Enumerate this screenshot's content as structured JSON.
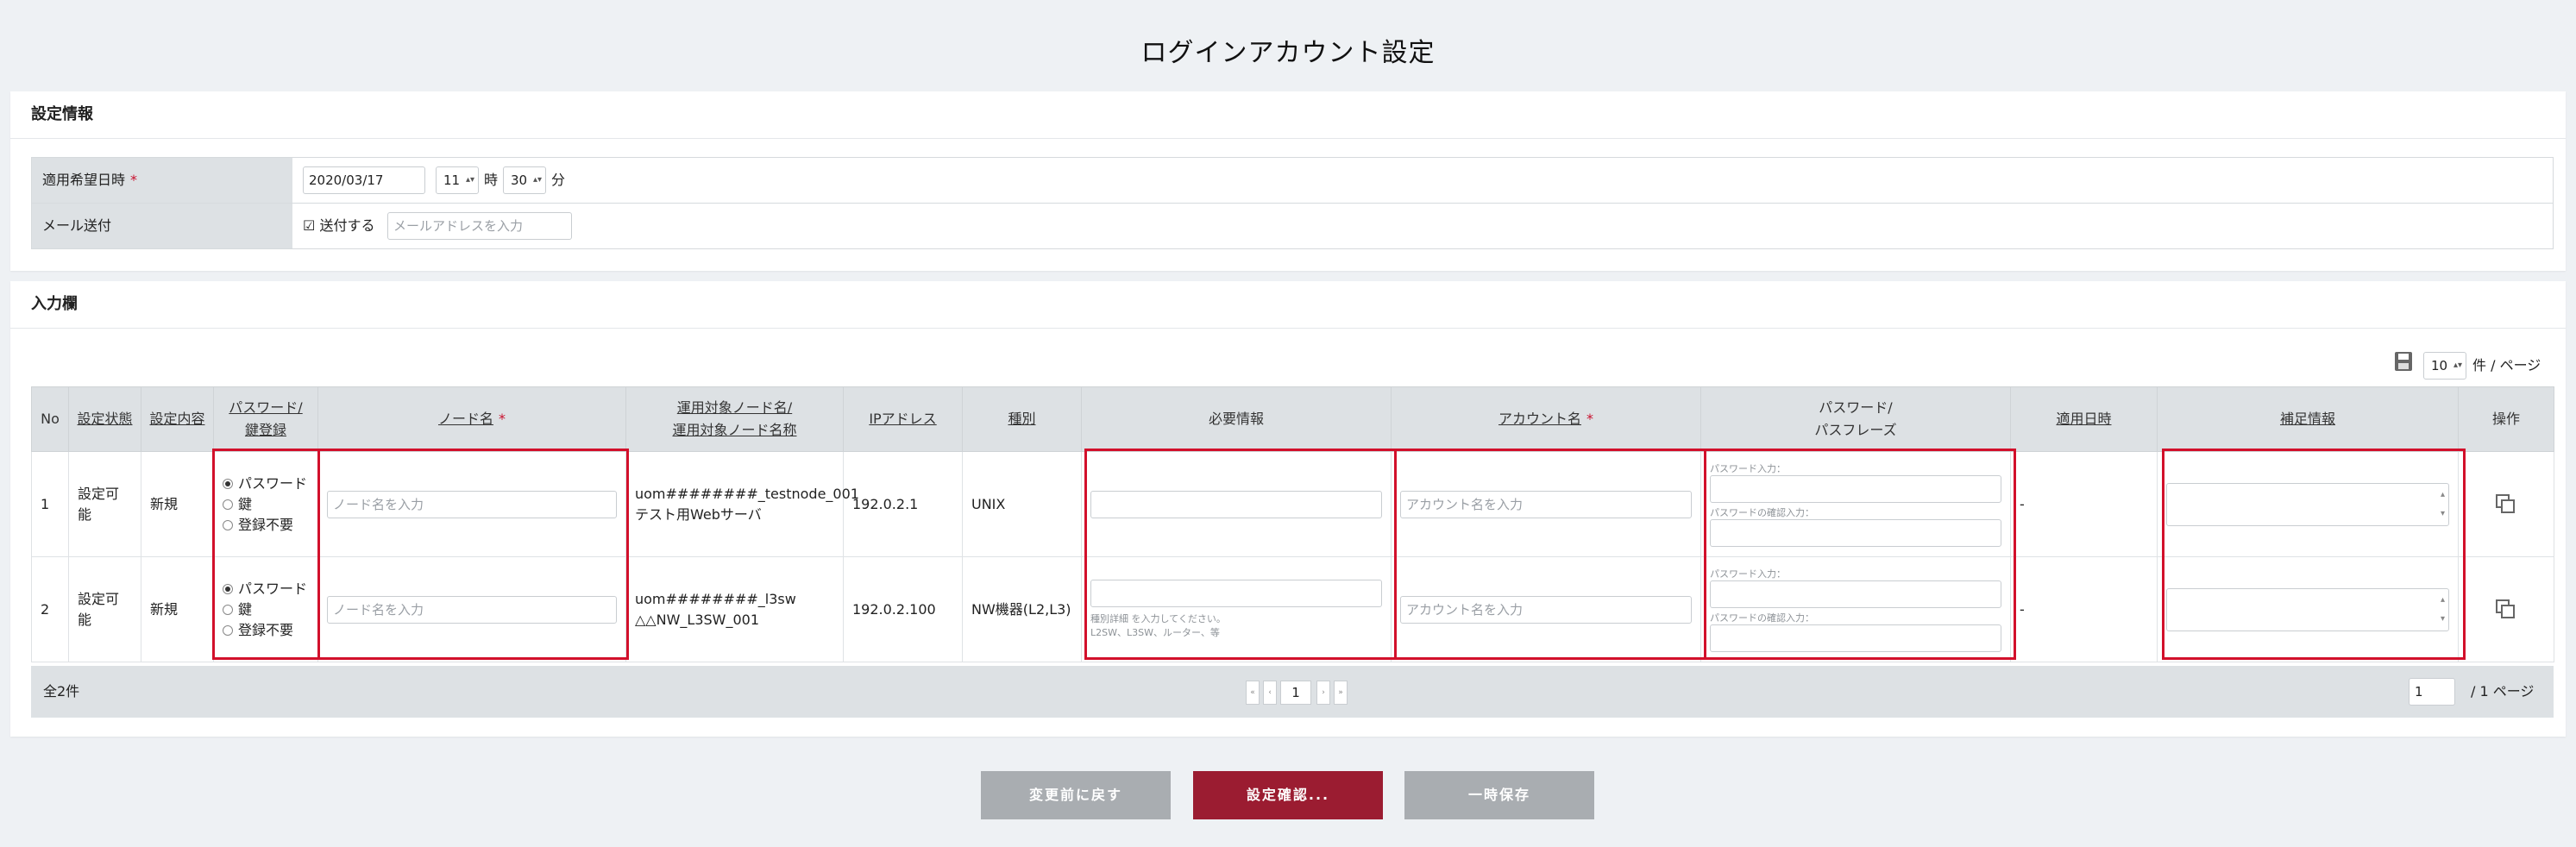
{
  "page": {
    "title": "ログインアカウント設定"
  },
  "settings": {
    "section_title": "設定情報",
    "date_label": "適用希望日時",
    "required_mark": "*",
    "date_value": "2020/03/17",
    "hour_value": "11",
    "hour_unit": "時",
    "minute_value": "30",
    "minute_unit": "分",
    "mail_label": "メール送付",
    "send_checkbox_label": "送付する",
    "send_checked": true,
    "mail_placeholder": "メールアドレスを入力"
  },
  "input_section": {
    "title": "入力欄",
    "per_page_value": "10",
    "per_page_unit": "件 / ページ",
    "columns": [
      "No",
      "設定状態",
      "設定内容",
      "パスワード/鍵登録",
      "ノード名",
      "運用対象ノード名/運用対象ノード名称",
      "IPアドレス",
      "種別",
      "必要情報",
      "アカウント名",
      "パスワード/パスフレーズ",
      "適用日時",
      "補足情報",
      "操作"
    ],
    "col_pwkey_line1": "パスワード/",
    "col_pwkey_line2": "鍵登録",
    "col_target_line1": "運用対象ノード名/",
    "col_target_line2": "運用対象ノード名称",
    "col_pass_line1": "パスワード/",
    "col_pass_line2": "パスフレーズ",
    "radio_password": "パスワード",
    "radio_key": "鍵",
    "radio_none": "登録不要",
    "node_placeholder": "ノード名を入力",
    "account_placeholder": "アカウント名を入力",
    "pw_input_label": "パスワード入力：",
    "pw_confirm_label": "パスワードの確認入力：",
    "rows": [
      {
        "no": "1",
        "status": "設定可能",
        "content": "新規",
        "target_name": "uom########_testnode_001",
        "target_label": "テスト用Webサーバ",
        "ip": "192.0.2.1",
        "type": "UNIX",
        "required_hint_line1": "",
        "required_hint_line2": "",
        "applied": "-"
      },
      {
        "no": "2",
        "status": "設定可能",
        "content": "新規",
        "target_name": "uom########_l3sw",
        "target_label": "△△NW_L3SW_001",
        "ip": "192.0.2.100",
        "type": "NW機器(L2,L3)",
        "required_hint_line1": "種別詳細 を入力してください。",
        "required_hint_line2": "L2SW、L3SW、ルーター、等",
        "applied": "-"
      }
    ],
    "total": "全2件",
    "current_page": "1",
    "page_input": "1",
    "page_total": "/ 1 ページ"
  },
  "buttons": {
    "revert": "変更前に戻す",
    "confirm": "設定確認...",
    "temp_save": "一時保存"
  },
  "colors": {
    "accent": "#9b1c31",
    "muted_button": "#a9adb1",
    "highlight_border": "#d2102b"
  }
}
